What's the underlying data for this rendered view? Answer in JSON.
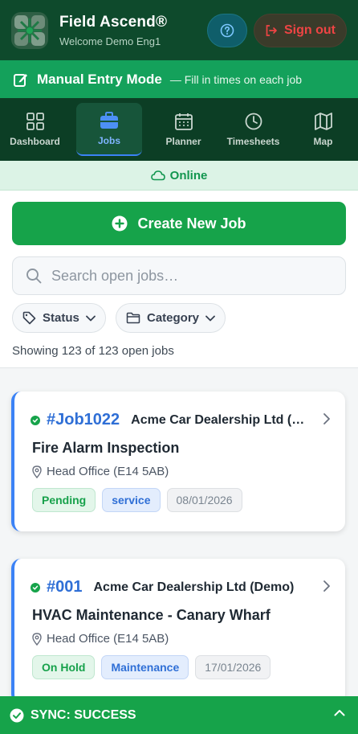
{
  "header": {
    "app_title": "Field Ascend®",
    "welcome": "Welcome Demo Eng1",
    "signout_label": "Sign out"
  },
  "mode_banner": {
    "title": "Manual Entry Mode",
    "subtitle": "— Fill in times on each job"
  },
  "nav": {
    "items": [
      {
        "label": "Dashboard",
        "icon": "grid-icon"
      },
      {
        "label": "Jobs",
        "icon": "briefcase-icon",
        "active": true
      },
      {
        "label": "Planner",
        "icon": "calendar-icon"
      },
      {
        "label": "Timesheets",
        "icon": "clock-icon"
      },
      {
        "label": "Map",
        "icon": "map-icon"
      }
    ]
  },
  "status": {
    "online_label": "Online"
  },
  "actions": {
    "create_label": "Create New Job",
    "search_placeholder": "Search open jobs…",
    "filter_status": "Status",
    "filter_category": "Category",
    "count_text": "Showing 123 of 123 open jobs"
  },
  "jobs": [
    {
      "number": "#Job1022",
      "customer": "Acme Car Dealership Ltd (…",
      "title": "Fire Alarm Inspection",
      "location": "Head Office (E14 5AB)",
      "status": "Pending",
      "category": "service",
      "date": "08/01/2026"
    },
    {
      "number": "#001",
      "customer": "Acme Car Dealership Ltd (Demo)",
      "title": "HVAC Maintenance - Canary Wharf",
      "location": "Head Office (E14 5AB)",
      "status": "On Hold",
      "category": "Maintenance",
      "date": "17/01/2026"
    }
  ],
  "sync": {
    "label": "SYNC: SUCCESS"
  },
  "colors": {
    "header_bg": "#0e4a2c",
    "accent_green": "#16a34a",
    "accent_blue": "#3b82f6",
    "danger": "#ef4444"
  }
}
